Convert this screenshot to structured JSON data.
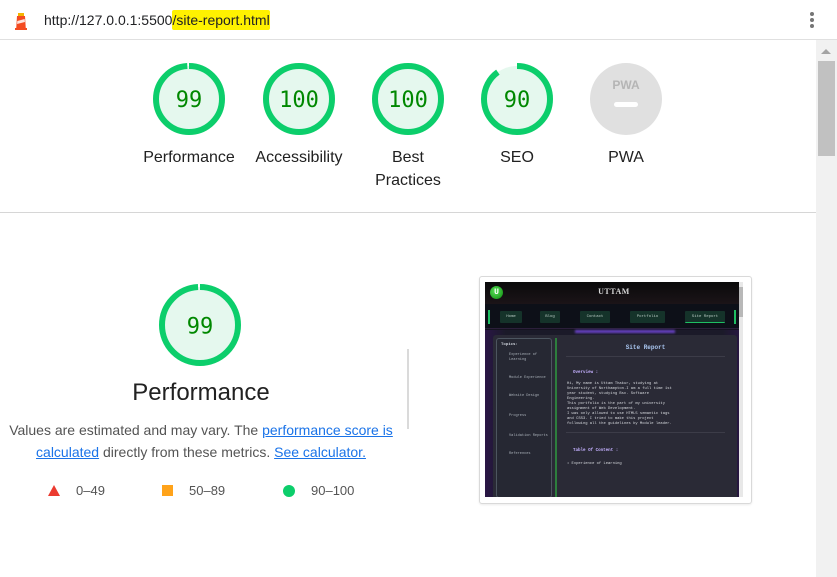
{
  "browser": {
    "url_prefix": "http://127.0.0.1:5500",
    "url_highlighted": "/site-report.html",
    "logo_icon": "lighthouse-icon",
    "menu_icon": "kebab-menu-icon"
  },
  "colors": {
    "pass": "#0cce6b",
    "pass_fill": "#e5f8ee",
    "pass_text": "#008800",
    "average": "#ffa31a",
    "fail": "#eb3a2f",
    "na": "#e0e0e0",
    "link": "#1a73e8",
    "highlight": "#fff200"
  },
  "gauges": [
    {
      "label": "Performance",
      "score": 99
    },
    {
      "label": "Accessibility",
      "score": 100
    },
    {
      "label": "Best Practices",
      "score": 100
    },
    {
      "label": "SEO",
      "score": 90
    },
    {
      "label": "PWA",
      "score": null,
      "badge": "PWA"
    }
  ],
  "performance": {
    "score": 99,
    "title": "Performance",
    "desc_1": "Values are estimated and may vary. The ",
    "link_1": "performance score is calculated",
    "desc_2": " directly from these metrics. ",
    "link_2": "See calculator.",
    "legend": [
      {
        "shape": "triangle",
        "range": "0–49"
      },
      {
        "shape": "square",
        "range": "50–89"
      },
      {
        "shape": "circle",
        "range": "90–100"
      }
    ]
  },
  "screenshot": {
    "site_title": "UTTAM",
    "logo_letter": "U",
    "nav": [
      "Home",
      "Blog",
      "Contact",
      "Portfolio",
      "Site Report"
    ],
    "topics_label": "Topics:",
    "topics": [
      "Experience of Learning",
      "Module Experience",
      "Website Design",
      "Progress",
      "Validation Reports",
      "References"
    ],
    "heading": "Site Report",
    "overview_label": "Overview :",
    "overview_text": "Hi, My name is Uttam Thakur, studying at\nUniversity of Northampton.I am a full time 1st\nyear student, studying Bsc. Software\nEngineering.\nThis portfolio is the part of my university\nassignment of Web Development.\nI was only allowed to use HTML5 semantic tags\nand CSS3. I tried to make this project\nfollowing all the guidelines by Module leader.",
    "toc_label": "Table Of Content :",
    "toc_first": "• Experience of Learning"
  }
}
